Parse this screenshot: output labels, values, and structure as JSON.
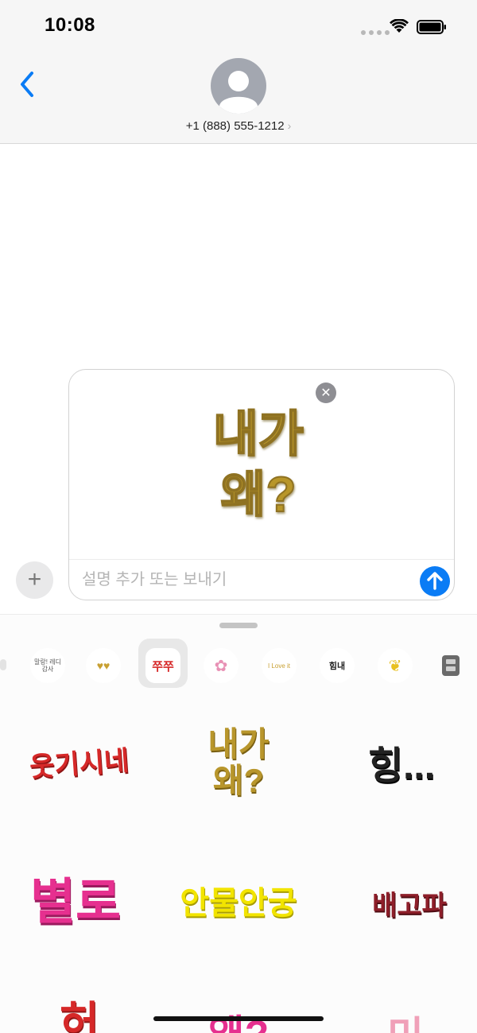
{
  "status": {
    "time": "10:08"
  },
  "header": {
    "contact": "+1 (888) 555-1212"
  },
  "compose": {
    "preview_sticker": [
      "내가",
      "왜?"
    ],
    "placeholder": "설명 추가 또는 보내기"
  },
  "tray": {
    "items": [
      {
        "label": "말랑! 레디감사",
        "icon": "sticker-pack-malang-icon"
      },
      {
        "label": "",
        "icon": "sticker-pack-hearts-icon"
      },
      {
        "label": "쭈쭈",
        "icon": "sticker-pack-selected-icon"
      },
      {
        "label": "",
        "icon": "sticker-pack-flower-icon"
      },
      {
        "label": "I Love it",
        "icon": "sticker-pack-love-icon"
      },
      {
        "label": "힘내",
        "icon": "sticker-pack-cheer-icon"
      },
      {
        "label": "",
        "icon": "sticker-pack-leaf-icon"
      },
      {
        "label": "",
        "icon": "sticker-pack-app-icon"
      }
    ]
  },
  "stickers": [
    {
      "text": "웃기시네",
      "color": "#d62828"
    },
    {
      "text_lines": [
        "내가",
        "왜?"
      ],
      "color": "#b8962c"
    },
    {
      "text": "힝...",
      "color": "#222222"
    },
    {
      "text": "별로",
      "color": "#e6308f"
    },
    {
      "text": "안물안궁",
      "color": "#f2e400"
    },
    {
      "text": "배고파",
      "color": "#8e1f2a"
    },
    {
      "text": "허",
      "color": "#d62828"
    },
    {
      "text": "왜?",
      "color": "#e6308f"
    },
    {
      "text": "미",
      "color": "#f0a0b8"
    }
  ],
  "colors": {
    "accent": "#0a7cf5",
    "sticker_gold": "#b8962c"
  }
}
